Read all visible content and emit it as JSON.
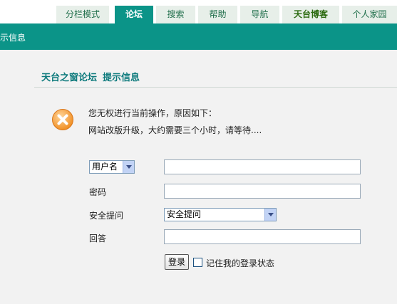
{
  "nav": {
    "tabs": [
      {
        "label": "分栏模式"
      },
      {
        "label": "论坛",
        "active": true
      },
      {
        "label": "搜索"
      },
      {
        "label": "帮助"
      },
      {
        "label": "导航"
      },
      {
        "label": "天台博客"
      },
      {
        "label": "个人家园"
      }
    ]
  },
  "header": {
    "crumb": "示信息"
  },
  "main": {
    "forum_name": "天台之窗论坛",
    "page_title": "提示信息",
    "message_line1": "您无权进行当前操作，原因如下：",
    "message_line2": "网站改版升级，大约需要三个小时，请等待...."
  },
  "login_form": {
    "username_select": "用户名",
    "password_label": "密码",
    "security_question_label": "安全提问",
    "security_question_select": "安全提问",
    "answer_label": "回答",
    "login_button": "登录",
    "remember_label": "记住我的登录状态"
  },
  "colors": {
    "accent": "#0b9488",
    "title": "#0d7a7c",
    "error_icon": "#f39a2b"
  },
  "icons": {
    "error": "error-x-icon",
    "dropdown": "chevron-down-icon"
  }
}
